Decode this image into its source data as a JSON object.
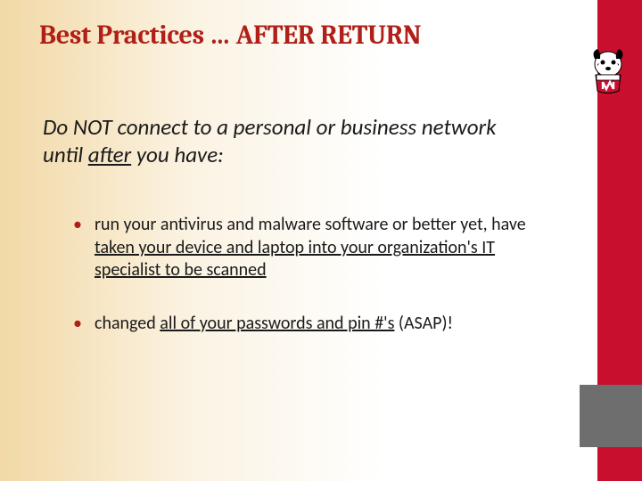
{
  "title": "Best Practices … AFTER RETURN",
  "intro": {
    "prefix": "Do NOT connect to a personal or business network until ",
    "underlined": "after",
    "suffix": " you have:"
  },
  "bullets": [
    {
      "prefix": "run your antivirus and malware software or better yet, have ",
      "underlined": "taken your device and laptop into your organization's IT specialist to be scanned",
      "suffix": ""
    },
    {
      "prefix": "changed ",
      "underlined": "all of your passwords and pin #'s",
      "suffix": " (ASAP)!"
    }
  ],
  "logo_name": "bucky-badger"
}
